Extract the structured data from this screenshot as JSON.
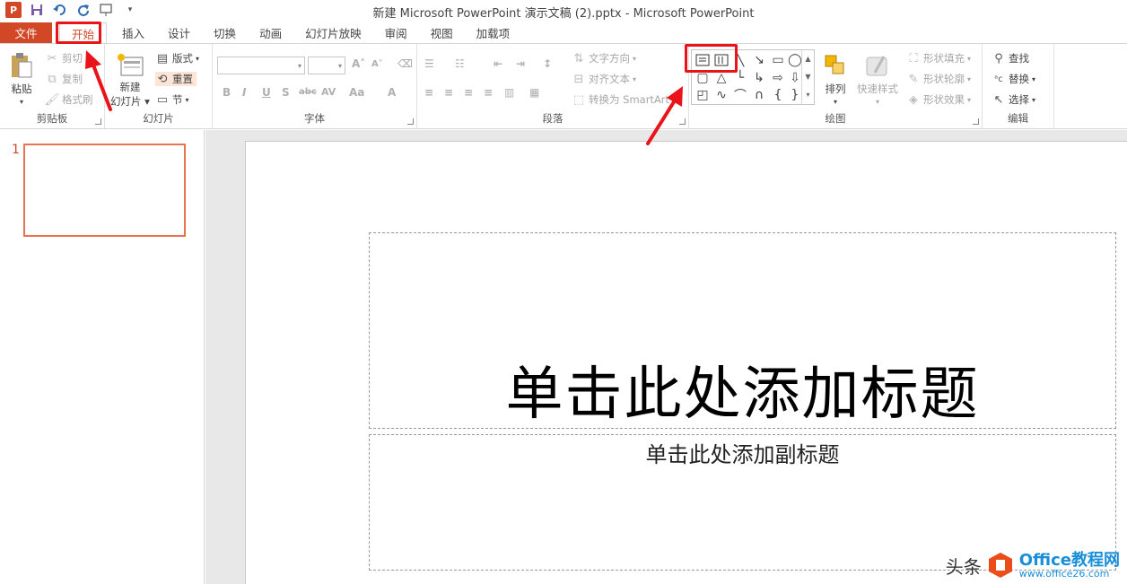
{
  "window": {
    "title": "新建 Microsoft PowerPoint 演示文稿 (2).pptx - Microsoft PowerPoint",
    "app_icon": "P"
  },
  "quick_access": [
    "save-icon",
    "undo-icon",
    "redo-icon",
    "start-presentation-icon",
    "customize-icon"
  ],
  "tabs": [
    {
      "label": "文件"
    },
    {
      "label": "开始"
    },
    {
      "label": "插入"
    },
    {
      "label": "设计"
    },
    {
      "label": "切换"
    },
    {
      "label": "动画"
    },
    {
      "label": "幻灯片放映"
    },
    {
      "label": "审阅"
    },
    {
      "label": "视图"
    },
    {
      "label": "加载项"
    }
  ],
  "ribbon": {
    "clipboard": {
      "label": "剪贴板",
      "paste": "粘贴",
      "cut": "剪切",
      "copy": "复制",
      "format_painter": "格式刷"
    },
    "slides": {
      "label": "幻灯片",
      "new_slide_line1": "新建",
      "new_slide_line2": "幻灯片",
      "layout": "版式",
      "reset": "重置",
      "section": "节"
    },
    "font": {
      "label": "字体",
      "bold": "B",
      "italic": "I",
      "underline": "U",
      "shadow": "S",
      "strike": "abc",
      "spacing": "AV",
      "case": "Aa",
      "grow": "A",
      "shrink": "A",
      "color": "A"
    },
    "paragraph": {
      "label": "段落",
      "text_direction": "文字方向",
      "align_text": "对齐文本",
      "smartart": "转换为 SmartArt"
    },
    "drawing": {
      "label": "绘图",
      "arrange": "排列",
      "quick_styles": "快速样式",
      "shape_fill": "形状填充",
      "shape_outline": "形状轮廓",
      "shape_effects": "形状效果"
    },
    "editing": {
      "label": "编辑",
      "find": "查找",
      "replace": "替换",
      "select": "选择"
    }
  },
  "thumbnails": [
    {
      "number": "1"
    }
  ],
  "slide": {
    "title_placeholder": "单击此处添加标题",
    "subtitle_placeholder": "单击此处添加副标题"
  },
  "watermark": {
    "prefix": "头条",
    "brand": "Office教程网",
    "url": "www.office26.com"
  },
  "colors": {
    "accent": "#d24726",
    "highlight": "#e8141a",
    "watermark": "#1a8fd8"
  }
}
